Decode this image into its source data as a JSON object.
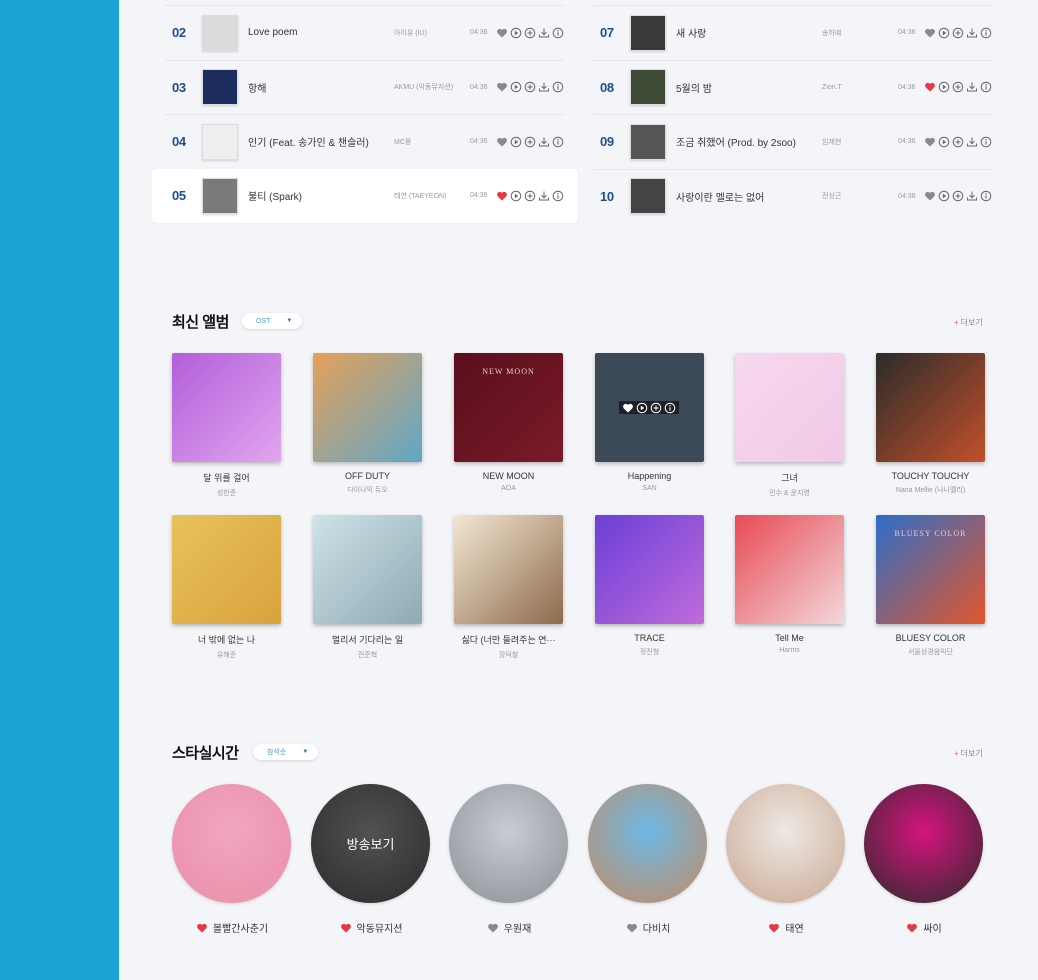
{
  "colors": {
    "sidebar": "#1ba3d6",
    "rank": "#1d4f8e",
    "heart_on": "#e63946",
    "heart_off": "#8a8a8a",
    "accent": "#4aa3d2"
  },
  "chart": {
    "left": [
      {
        "rank": "02",
        "title": "Love poem",
        "artist": "아이유 (IU)",
        "duration": "04:36",
        "liked": false,
        "art": "#dcdcdc"
      },
      {
        "rank": "03",
        "title": "항해",
        "artist": "AKMU (악동뮤지션)",
        "duration": "04:36",
        "liked": false,
        "art": "#1c2c5c"
      },
      {
        "rank": "04",
        "title": "인기 (Feat. 송가인 & 챈슬러)",
        "artist": "MC몽",
        "duration": "04:36",
        "liked": false,
        "art": "#eeeeee"
      },
      {
        "rank": "05",
        "title": "불티 (Spark)",
        "artist": "태연 (TAEYEON)",
        "duration": "04:36",
        "liked": true,
        "art": "#7a7a7a"
      }
    ],
    "right": [
      {
        "rank": "07",
        "title": "새 사랑",
        "artist": "송하예",
        "duration": "04:36",
        "liked": false,
        "art": "#3a3a3a"
      },
      {
        "rank": "08",
        "title": "5월의 밤",
        "artist": "Zion.T",
        "duration": "04:36",
        "liked": true,
        "art": "#3d4a35"
      },
      {
        "rank": "09",
        "title": "조금 취했어 (Prod. by 2soo)",
        "artist": "임재현",
        "duration": "04:36",
        "liked": false,
        "art": "#555555"
      },
      {
        "rank": "10",
        "title": "사랑이란 멜로는 없어",
        "artist": "전상근",
        "duration": "04:36",
        "liked": false,
        "art": "#444444"
      }
    ]
  },
  "albums_section": {
    "title": "최신 앨범",
    "filter": "OST",
    "more": "더보기",
    "more_plus": "+",
    "items": [
      {
        "title": "달 위를 걸어",
        "artist": "성한준",
        "c1": "#b35fd9",
        "c2": "#e2a6f0"
      },
      {
        "title": "OFF DUTY",
        "artist": "다이나믹 듀오",
        "c1": "#e6a05a",
        "c2": "#5fa7c8"
      },
      {
        "title": "NEW MOON",
        "artist": "AOA",
        "c1": "#5a0f1c",
        "c2": "#7a1a2a",
        "label": "NEW MOON"
      },
      {
        "title": "Happening",
        "artist": "SAN",
        "c1": "#3c4a57",
        "c2": "#3c4a57"
      },
      {
        "title": "그녀",
        "artist": "민수 & 윤지영",
        "c1": "#f7d8ee",
        "c2": "#f1c9e6"
      },
      {
        "title": "TOUCHY TOUCHY",
        "artist": "Nana Mellie (나나멜리)",
        "c1": "#2b2b2b",
        "c2": "#c1502a"
      },
      {
        "title": "너 밖에 없는 나",
        "artist": "유해준",
        "c1": "#e8c25b",
        "c2": "#d9a23d"
      },
      {
        "title": "멀리서 기다리는 일",
        "artist": "전준혁",
        "c1": "#cfe3e8",
        "c2": "#8faab3"
      },
      {
        "title": "싫다 (너만 들려주는 연···",
        "artist": "장덕철",
        "c1": "#f3e7d3",
        "c2": "#8e6a4d"
      },
      {
        "title": "TRACE",
        "artist": "정진형",
        "c1": "#6a3fd8",
        "c2": "#c06bd9"
      },
      {
        "title": "Tell Me",
        "artist": "Harms",
        "c1": "#e84a55",
        "c2": "#f3d7da"
      },
      {
        "title": "BLUESY COLOR",
        "artist": "서울상경음익단",
        "c1": "#2c6ec9",
        "c2": "#e2562b",
        "label": "BLUESY COLOR"
      }
    ]
  },
  "stars_section": {
    "title": "스타실시간",
    "filter": "참석순",
    "more": "더보기",
    "more_plus": "+",
    "broadcast_label": "방송보기",
    "items": [
      {
        "name": "볼빨간사춘기",
        "liked": true,
        "c1": "#f2a5c1",
        "c2": "#e98fa8"
      },
      {
        "name": "악동뮤지션",
        "liked": true,
        "c1": "#6d6d6d",
        "c2": "#3a3a3a"
      },
      {
        "name": "우원재",
        "liked": false,
        "c1": "#c9ccd3",
        "c2": "#8c8f96"
      },
      {
        "name": "다비치",
        "liked": false,
        "c1": "#6db9e6",
        "c2": "#c48b62"
      },
      {
        "name": "태연",
        "liked": true,
        "c1": "#eee8e4",
        "c2": "#c9a892"
      },
      {
        "name": "싸이",
        "liked": true,
        "c1": "#d6137e",
        "c2": "#2b2b2b"
      }
    ]
  }
}
